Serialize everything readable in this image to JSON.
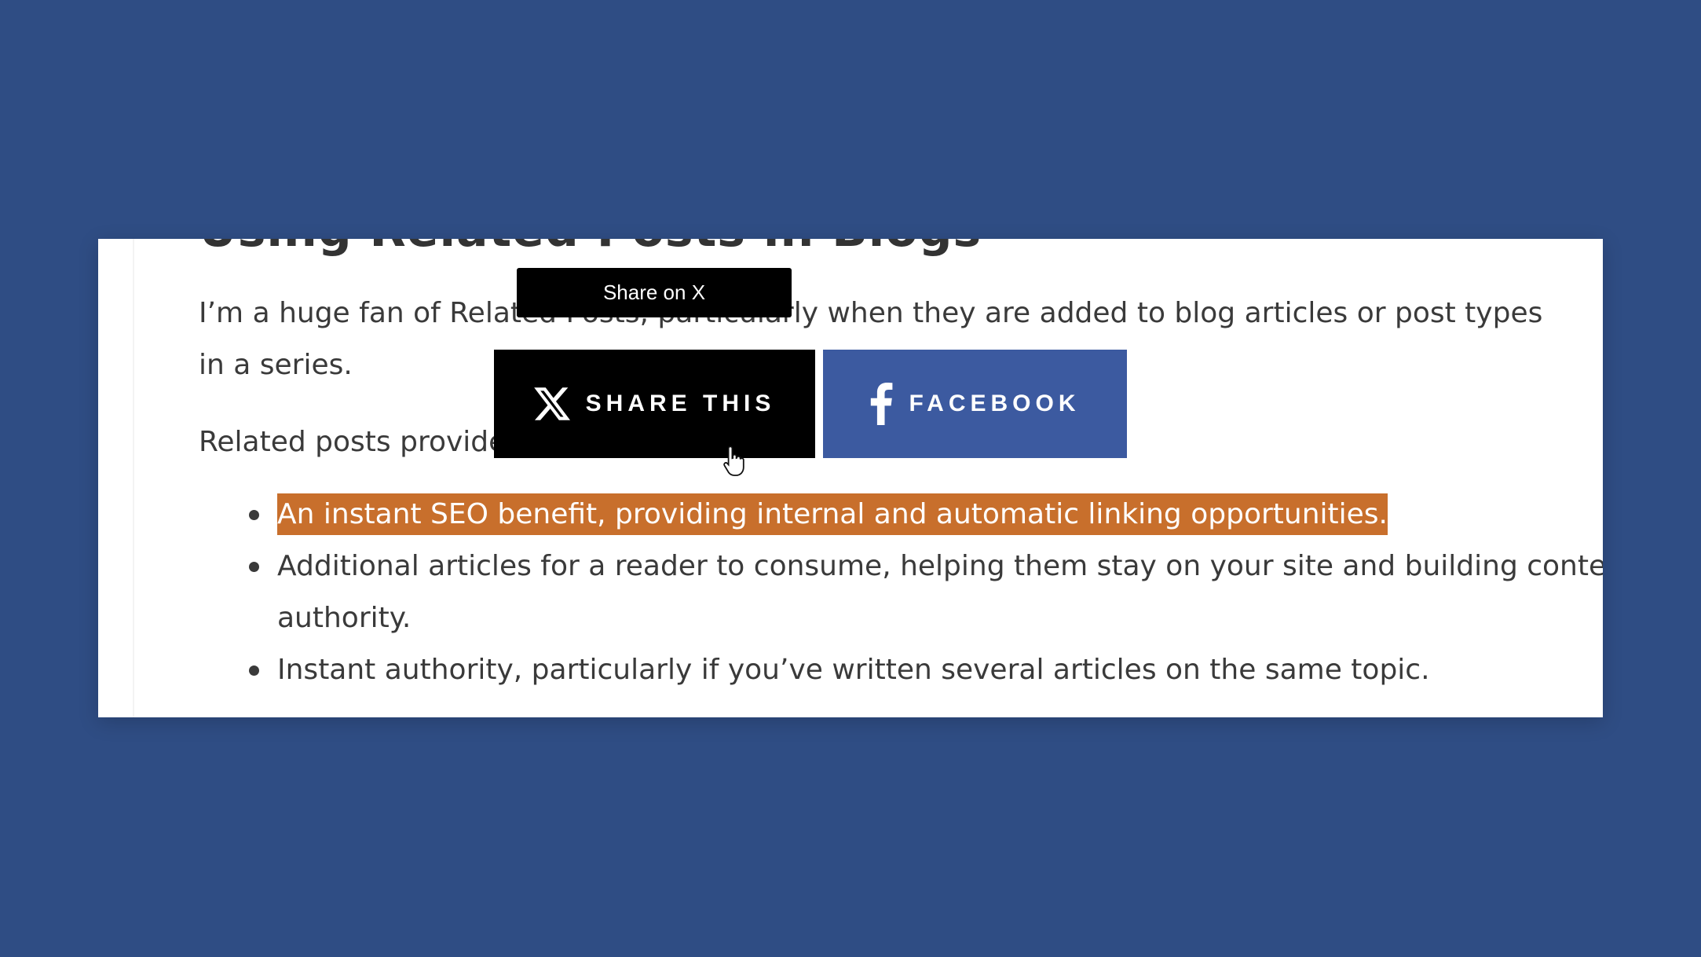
{
  "colors": {
    "background": "#2f4d84",
    "highlight": "#c86f2c",
    "x_button": "#000000",
    "facebook_button": "#3c5aa0"
  },
  "article": {
    "heading_fragment": "Using Related Posts in Blogs",
    "paragraph_1": "I’m a huge fan of Related Posts, particularly when they are added to blog articles or post types in a series.",
    "paragraph_2": "Related posts provide",
    "list_items": [
      "An instant SEO benefit, providing internal and automatic linking opportunities.",
      "Additional articles for a reader to consume, helping them stay on your site and building content authority.",
      "Instant authority, particularly if you’ve written several articles on the same topic."
    ]
  },
  "share": {
    "tooltip": "Share on X",
    "x_label": "SHARE THIS",
    "x_icon": "x-logo-icon",
    "facebook_label": "FACEBOOK",
    "facebook_icon": "facebook-icon"
  }
}
